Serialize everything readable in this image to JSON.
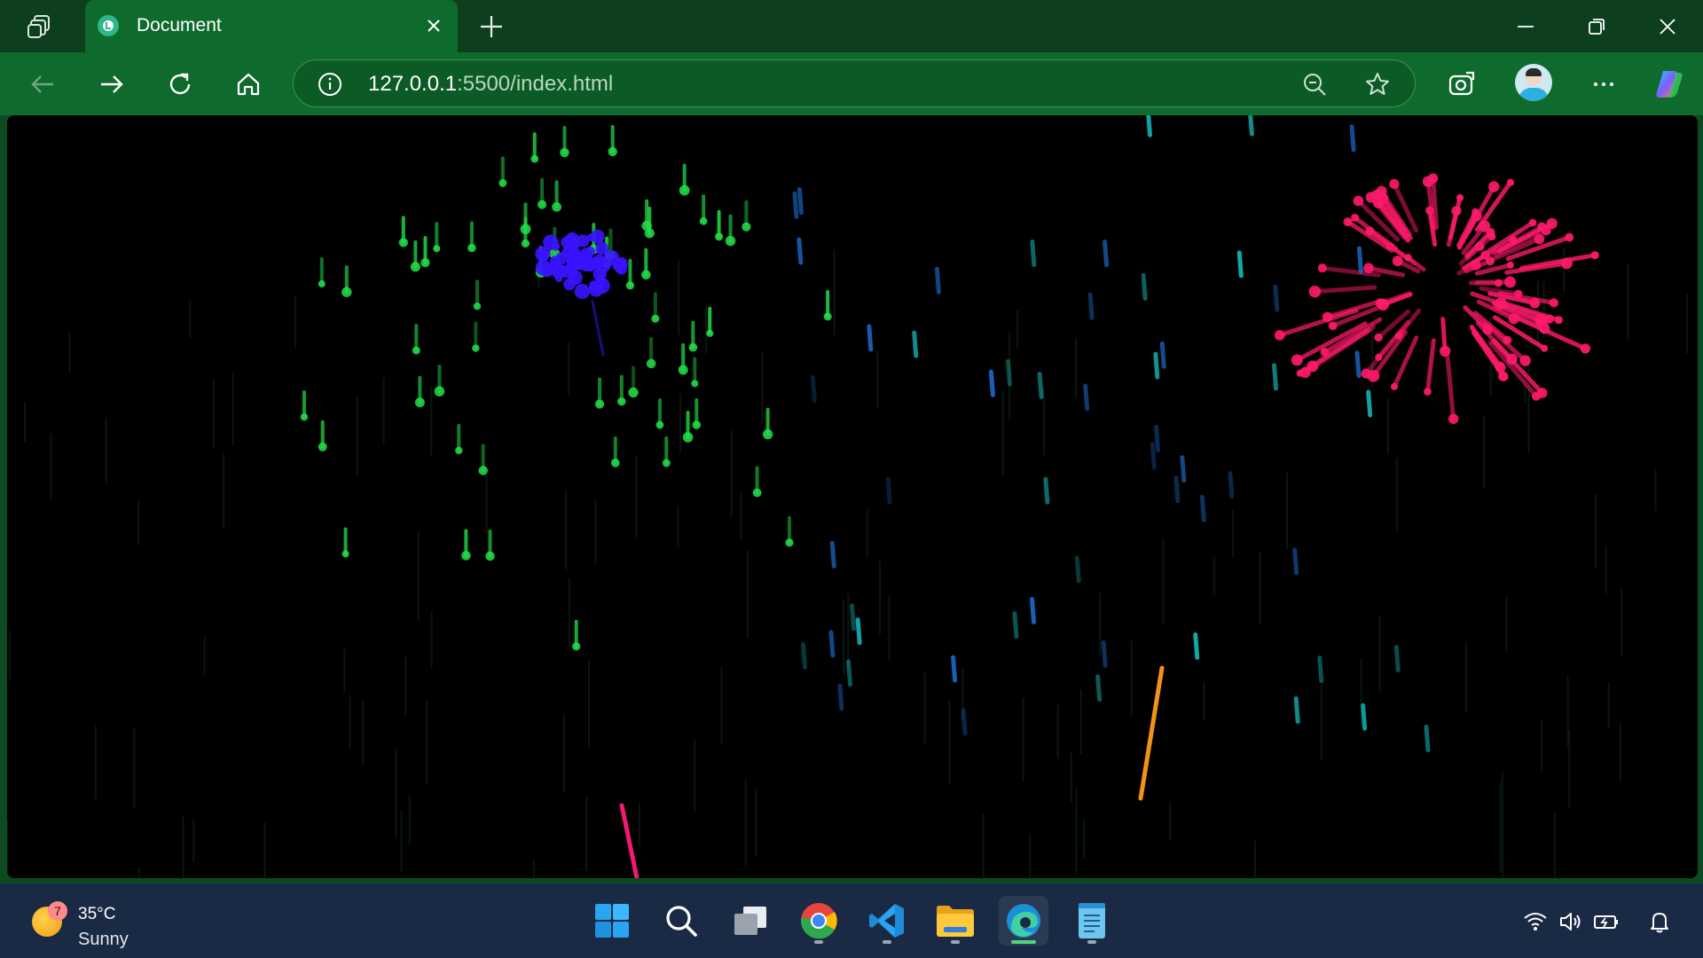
{
  "browser": {
    "tab": {
      "title": "Document"
    },
    "address": {
      "host": "127.0.0.1",
      "path": ":5500/index.html"
    }
  },
  "taskbar": {
    "weather": {
      "badge": "7",
      "temperature": "35°C",
      "condition": "Sunny"
    },
    "apps": [
      {
        "name": "start-icon"
      },
      {
        "name": "search-icon"
      },
      {
        "name": "task-view-icon"
      },
      {
        "name": "chrome-icon",
        "running": true
      },
      {
        "name": "vscode-icon",
        "running": true
      },
      {
        "name": "file-explorer-icon",
        "running": true
      },
      {
        "name": "edge-icon",
        "running": true,
        "active": true
      },
      {
        "name": "notepad-icon",
        "running": true
      }
    ],
    "tray": [
      "wifi-icon",
      "volume-icon",
      "battery-icon",
      "notification-bell-icon"
    ]
  },
  "colors": {
    "titlebar": "#0d3f1e",
    "toolbar": "#0f6a2d",
    "canvas": "#000000",
    "firework_green": "#22e04a",
    "firework_blue": "#3a14ff",
    "firework_pink": "#ff1a6b",
    "rain_cyan": "#19c9c9",
    "rocket_orange": "#ff9a1a",
    "rocket_pink": "#ff1a7a"
  }
}
